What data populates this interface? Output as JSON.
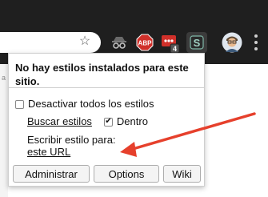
{
  "colors": {
    "toolbar_bg": "#1f1f1f",
    "accent_arrow": "#e6402c",
    "abp_red": "#d0302a",
    "badge_bg": "#555555",
    "stylus_bg": "#3b3b3b"
  },
  "toolbar": {
    "bookmark_icon": "star-outline-icon",
    "extensions": [
      {
        "name": "spy-extension-icon"
      },
      {
        "name": "adblock-plus-icon",
        "label": "ABP"
      },
      {
        "name": "dots-extension-icon",
        "badge": "4"
      },
      {
        "name": "stylus-icon",
        "label": "S"
      }
    ],
    "avatar_icon": "profile-avatar-icon",
    "menu_icon": "kebab-menu-icon"
  },
  "popup": {
    "header": "No hay estilos instalados para este sitio.",
    "disable_all_label": "Desactivar todos los estilos",
    "disable_all_checked": false,
    "find_styles_link": "Buscar estilos",
    "inside_label": "Dentro",
    "inside_checked": true,
    "write_style_label": "Escribir estilo para:",
    "write_style_link": "este URL",
    "buttons": {
      "manage": "Administrar",
      "options": "Options",
      "wiki": "Wiki"
    }
  },
  "page_edge_text": "a"
}
